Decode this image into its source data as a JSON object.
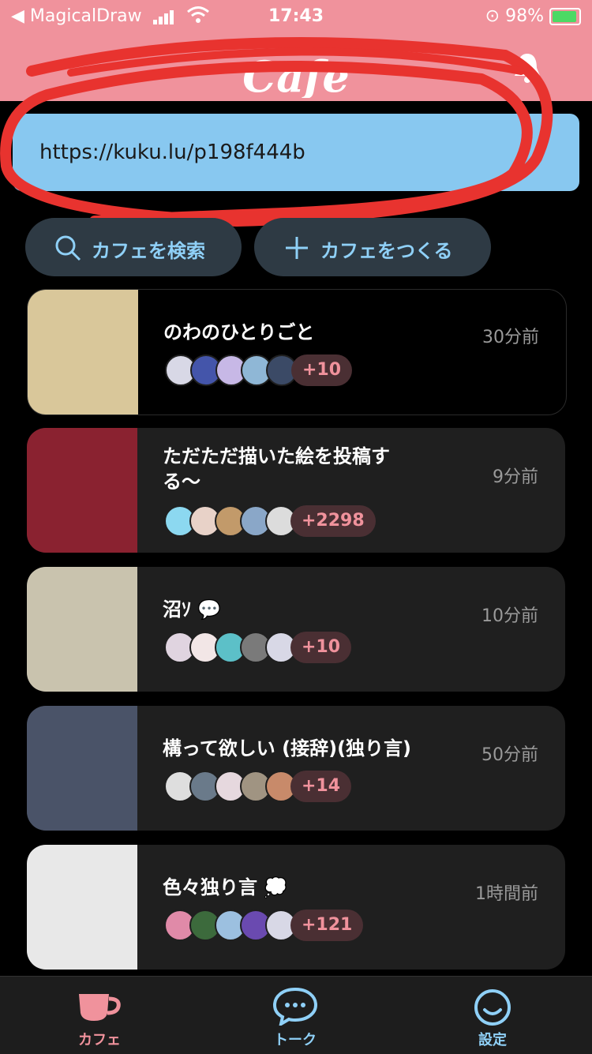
{
  "status": {
    "back_app": "◀ MagicalDraw",
    "time": "17:43",
    "battery": "98%"
  },
  "header": {
    "logo": "Cafe",
    "bell_icon": "bell-icon"
  },
  "url_bar": {
    "url": "https://kuku.lu/p198f444b"
  },
  "actions": {
    "search_label": "カフェを検索",
    "create_label": "カフェをつくる"
  },
  "cafes": [
    {
      "title": "のわのひとりごと",
      "time": "30分前",
      "count": "+10",
      "thumb_color": "#d9c79a",
      "avatar_colors": [
        "#d8d8e6",
        "#4455aa",
        "#c7b8e6",
        "#8fb7d6",
        "#3b4a66"
      ]
    },
    {
      "title": "ただただ描いた絵を投稿する〜",
      "time": "9分前",
      "count": "+2298",
      "thumb_color": "#8a2230",
      "avatar_colors": [
        "#8cd8f0",
        "#e8d2c8",
        "#c29a6a",
        "#8aa7c8",
        "#dcdcdc"
      ]
    },
    {
      "title": "沼ｿ 💬",
      "time": "10分前",
      "count": "+10",
      "thumb_color": "#c9c3ae",
      "avatar_colors": [
        "#e0d4e0",
        "#f2e6e6",
        "#5cc0c8",
        "#7a7a7a",
        "#d8d8e6"
      ]
    },
    {
      "title": "構って欲しい (接辞)(独り言)",
      "time": "50分前",
      "count": "+14",
      "thumb_color": "#4a5368",
      "avatar_colors": [
        "#dedede",
        "#6a7a8a",
        "#e6d8de",
        "#a09482",
        "#c88a6a"
      ]
    },
    {
      "title": "色々独り言 💭",
      "time": "1時間前",
      "count": "+121",
      "thumb_color": "#e8e8e8",
      "avatar_colors": [
        "#e08aa8",
        "#3c6a3c",
        "#9cc0e0",
        "#6a4ab0",
        "#d8d8e6"
      ]
    }
  ],
  "tabs": [
    {
      "label": "カフェ",
      "icon": "coffee-cup-icon",
      "active": true,
      "color": "#f0929c"
    },
    {
      "label": "トーク",
      "icon": "chat-bubble-icon",
      "active": false,
      "color": "#8fd0f7"
    },
    {
      "label": "設定",
      "icon": "smile-face-icon",
      "active": false,
      "color": "#8fd0f7"
    }
  ],
  "colors": {
    "accent": "#f0929c",
    "url_bar": "#88c8f0",
    "scribble": "#e8332f",
    "button_text": "#8fd0f7"
  }
}
